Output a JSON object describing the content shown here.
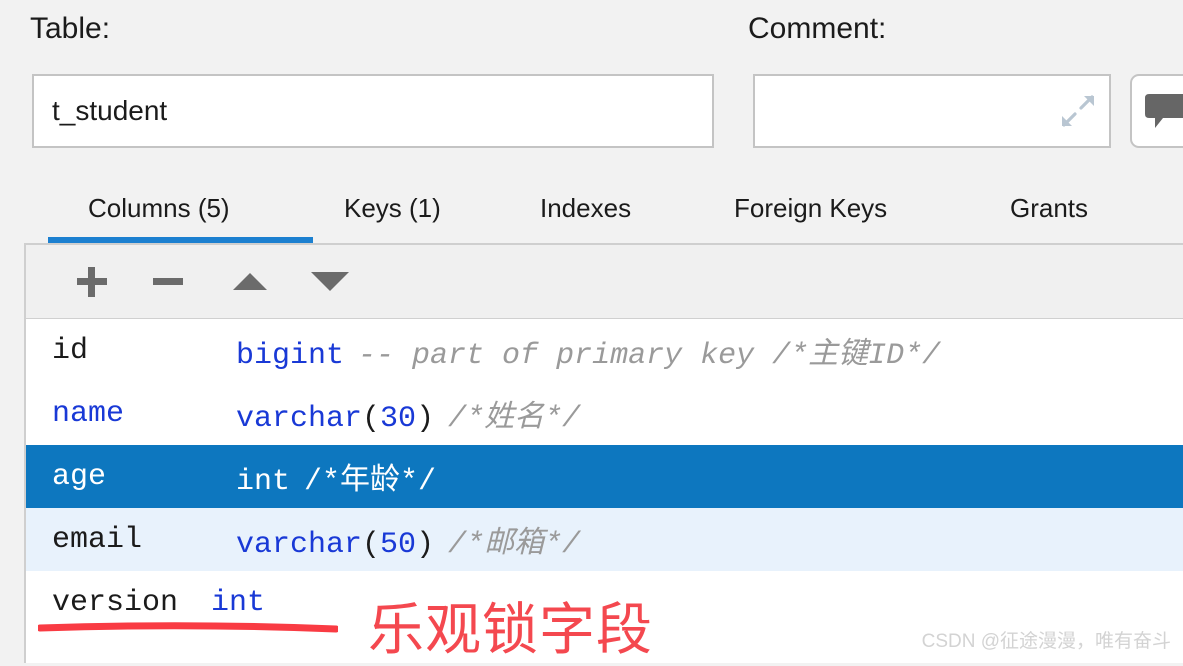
{
  "form": {
    "table_label": "Table:",
    "table_value": "t_student",
    "comment_label": "Comment:",
    "comment_value": "",
    "comment_placeholder": "",
    "expand_icon": "expand-diagonal-icon",
    "comment_button_icon": "speech-bubble-icon"
  },
  "tabs": [
    {
      "label": "Columns (5)",
      "active": true
    },
    {
      "label": "Keys (1)",
      "active": false
    },
    {
      "label": "Indexes",
      "active": false
    },
    {
      "label": "Foreign Keys",
      "active": false
    },
    {
      "label": "Grants",
      "active": false
    }
  ],
  "toolbar": {
    "add_icon": "plus-icon",
    "remove_icon": "minus-icon",
    "move_up_icon": "triangle-up-icon",
    "move_down_icon": "triangle-down-icon"
  },
  "grid": {
    "rows": [
      {
        "name": "id",
        "name_color": "black",
        "type": "bigint",
        "length": "",
        "comment": "-- part of primary key /*主键ID*/",
        "state": "normal"
      },
      {
        "name": "name",
        "name_color": "blue",
        "type": "varchar",
        "length": "30",
        "comment": "/*姓名*/",
        "state": "normal"
      },
      {
        "name": "age",
        "name_color": "black",
        "type": "int",
        "length": "",
        "comment": "/*年龄*/",
        "state": "selected"
      },
      {
        "name": "email",
        "name_color": "black",
        "type": "varchar",
        "length": "50",
        "comment": "/*邮箱*/",
        "state": "alt"
      },
      {
        "name": "version",
        "name_color": "black",
        "type": "int",
        "length": "",
        "comment": "",
        "state": "normal"
      }
    ]
  },
  "annotations": {
    "underline_color": "#f93b43",
    "note_text": "乐观锁字段",
    "note_color": "#f4484f"
  },
  "watermark": {
    "text": "CSDN @征途漫漫，唯有奋斗"
  },
  "colors": {
    "background": "#f2f2f2",
    "selection_blue": "#0d77bf",
    "tab_underline_blue": "#1c80d0",
    "alt_row_blue": "#e8f2fc",
    "keyword_blue": "#1939d6",
    "comment_gray": "#9a9a9a"
  }
}
